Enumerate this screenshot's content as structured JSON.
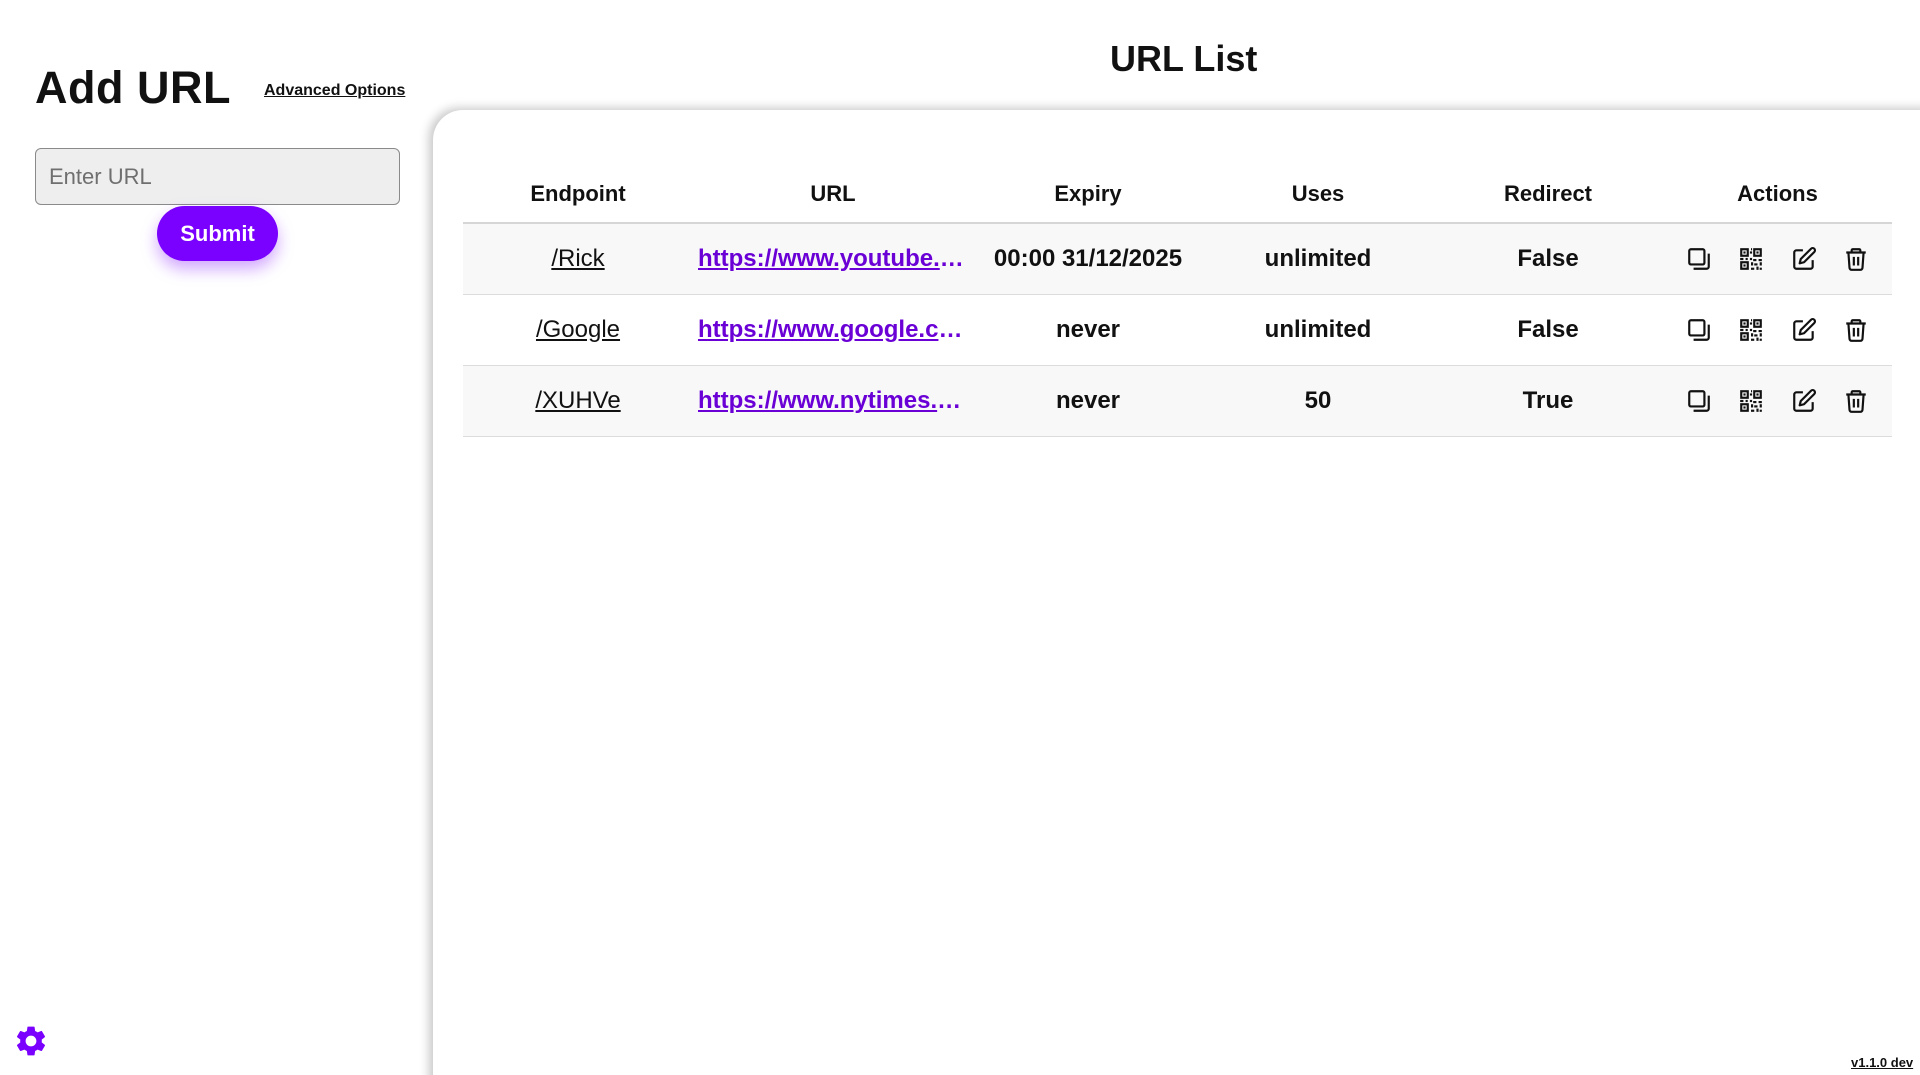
{
  "sidebar": {
    "title": "Add URL",
    "advanced_options_label": "Advanced Options",
    "url_input": {
      "value": "",
      "placeholder": "Enter URL"
    },
    "submit_label": "Submit",
    "settings_icon": "gear-icon"
  },
  "main": {
    "title": "URL List",
    "columns": [
      "Endpoint",
      "URL",
      "Expiry",
      "Uses",
      "Redirect",
      "Actions"
    ],
    "rows": [
      {
        "endpoint": "/Rick",
        "url": "https://www.youtube.c...",
        "expiry": "00:00 31/12/2025",
        "uses": "unlimited",
        "redirect": "False"
      },
      {
        "endpoint": "/Google",
        "url": "https://www.google.com",
        "expiry": "never",
        "uses": "unlimited",
        "redirect": "False"
      },
      {
        "endpoint": "/XUHVe",
        "url": "https://www.nytimes.c...",
        "expiry": "never",
        "uses": "50",
        "redirect": "True"
      }
    ],
    "row_actions": [
      "copy-icon",
      "qr-code-icon",
      "edit-icon",
      "trash-icon"
    ]
  },
  "footer": {
    "version": "v1.1.0 dev"
  },
  "colors": {
    "accent": "#7a00ff",
    "link": "#6a00d6"
  }
}
